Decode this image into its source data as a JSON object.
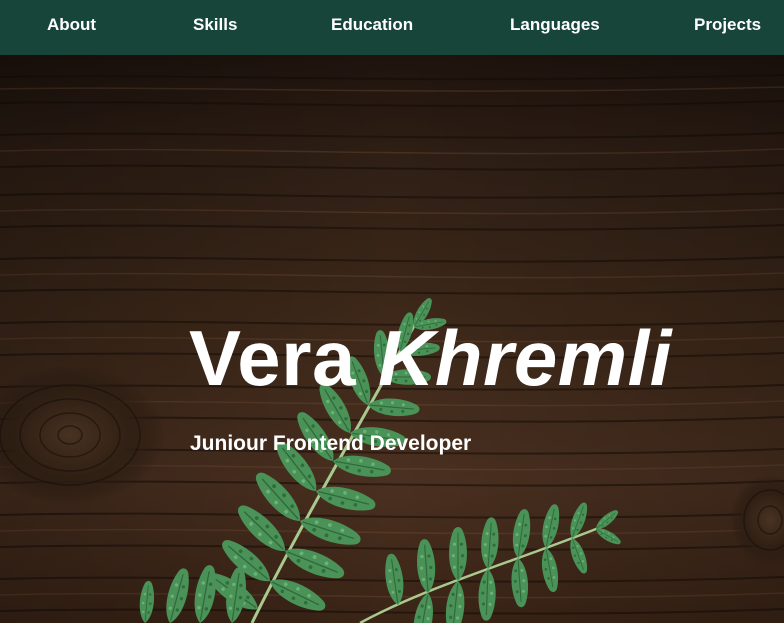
{
  "nav": {
    "items": [
      {
        "label": "About"
      },
      {
        "label": "Skills"
      },
      {
        "label": "Education"
      },
      {
        "label": "Languages"
      },
      {
        "label": "Projects"
      }
    ]
  },
  "hero": {
    "first_name": "Vera",
    "last_name": "Khremli",
    "subtitle": "Juniour Frontend Developer",
    "background_image": "dark-wood-with-fern-leaf"
  },
  "colors": {
    "nav_background": "#17453a",
    "text": "#ffffff",
    "wood": "#3a2517",
    "fern": "#3f8b4e"
  }
}
